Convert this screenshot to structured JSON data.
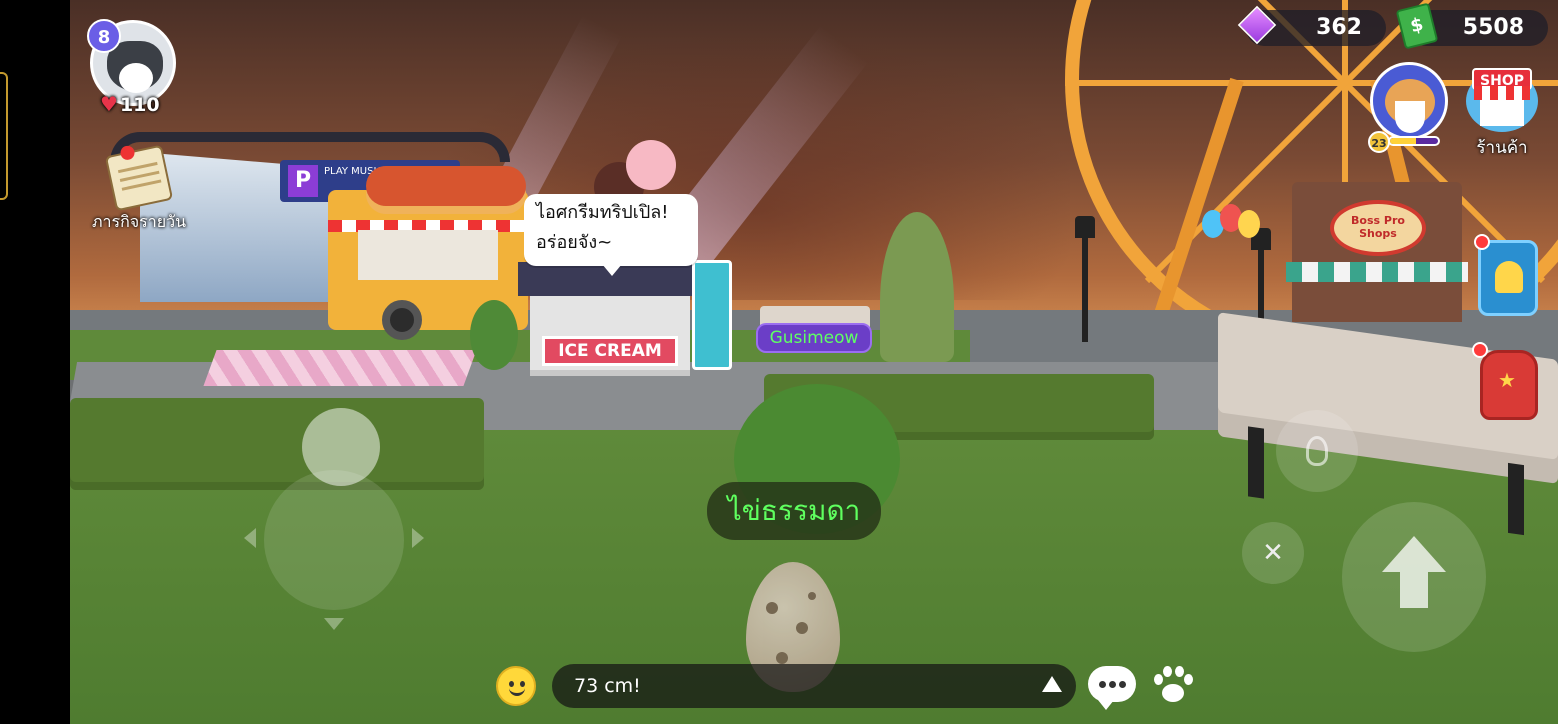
{
  "player": {
    "level": "8",
    "hearts": "110",
    "avatar_icon": "husky-avatar-icon"
  },
  "daily_quest": {
    "label": "ภารกิจรายวัน",
    "icon": "scroll-icon"
  },
  "currency": {
    "gems": "362",
    "cash": "5508",
    "gem_icon": "purple-gem-icon",
    "cash_icon": "cash-bill-icon"
  },
  "pet": {
    "level": "23",
    "xp_fraction": 0.55
  },
  "shop": {
    "badge": "SHOP",
    "label": "ร้านค้า"
  },
  "world": {
    "npc_speech": "ไอศกรีมทริปเปิล! อร่อยจัง~",
    "npc_speech_line1": "ไอศกรีมทริปเปิล!",
    "npc_speech_line2": "อร่อยจัง~",
    "player_name_tag": "Gusimeow",
    "held_item_label": "ไข่ธรรมดา",
    "ice_cream_stand_sign": "ICE CREAM",
    "festival_sign": "PLAY MUSIC FESTIVAL",
    "boss_shop_sign": "Boss Pro Shops"
  },
  "chat": {
    "input_value": "73 cm!"
  },
  "colors": {
    "name_tag_text": "#5fff64",
    "item_label_text": "#5fff5f",
    "level_badge": "#6a5ee6",
    "shop_badge": "#e62f3b"
  }
}
